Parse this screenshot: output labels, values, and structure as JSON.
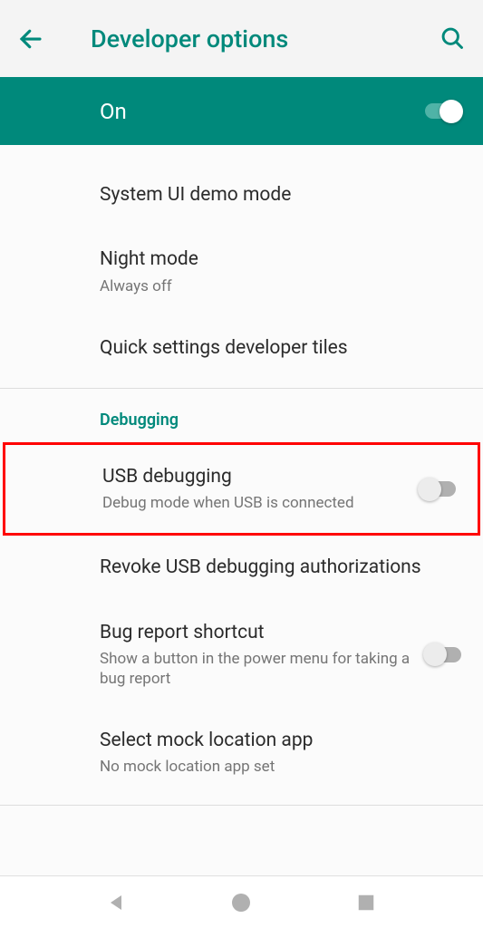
{
  "header": {
    "title": "Developer options"
  },
  "master_toggle": {
    "label": "On",
    "enabled": true
  },
  "section1": {
    "items": [
      {
        "title": "System UI demo mode",
        "subtitle": ""
      },
      {
        "title": "Night mode",
        "subtitle": "Always off"
      },
      {
        "title": "Quick settings developer tiles",
        "subtitle": ""
      }
    ]
  },
  "debugging_section": {
    "header": "Debugging",
    "items": [
      {
        "title": "USB debugging",
        "subtitle": "Debug mode when USB is connected",
        "toggle": false,
        "highlighted": true
      },
      {
        "title": "Revoke USB debugging authorizations",
        "subtitle": ""
      },
      {
        "title": "Bug report shortcut",
        "subtitle": "Show a button in the power menu for taking a bug report",
        "toggle": false
      },
      {
        "title": "Select mock location app",
        "subtitle": "No mock location app set"
      }
    ]
  }
}
